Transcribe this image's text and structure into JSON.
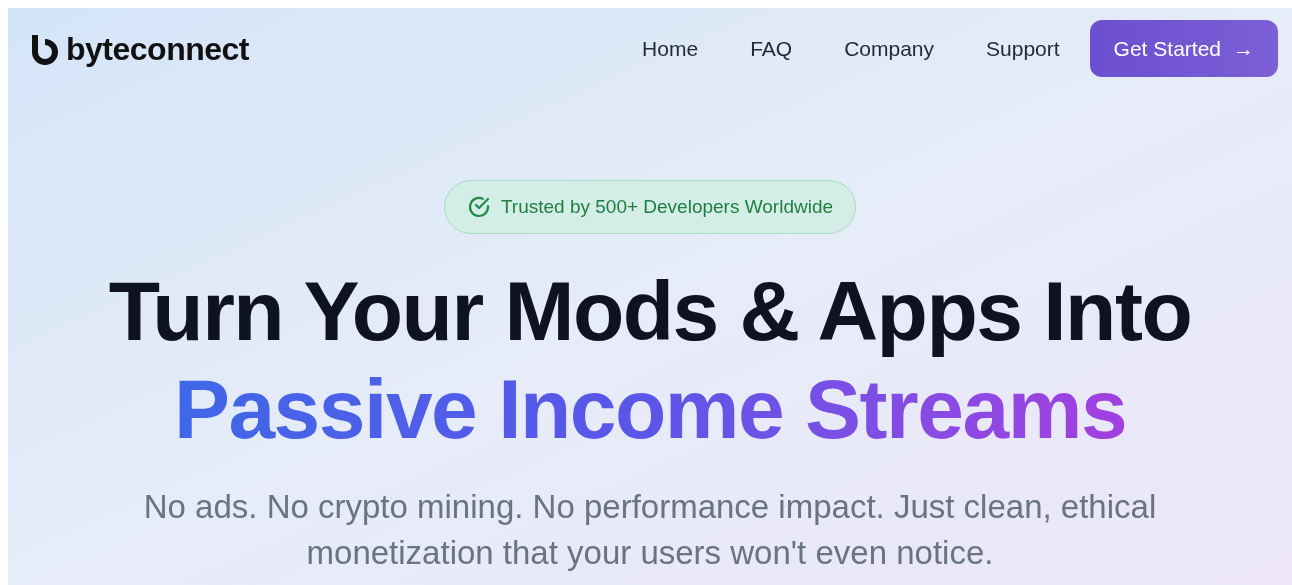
{
  "brand": {
    "name": "byteconnect"
  },
  "nav": {
    "links": [
      "Home",
      "FAQ",
      "Company",
      "Support"
    ],
    "cta": {
      "label": "Get Started",
      "icon": "→"
    }
  },
  "hero": {
    "badge": "Trusted by 500+ Developers Worldwide",
    "title_line_1": "Turn Your Mods & Apps Into",
    "title_line_2": "Passive Income Streams",
    "subtitle": "No ads. No crypto mining. No performance impact. Just clean, ethical monetization that your users won't even notice."
  }
}
